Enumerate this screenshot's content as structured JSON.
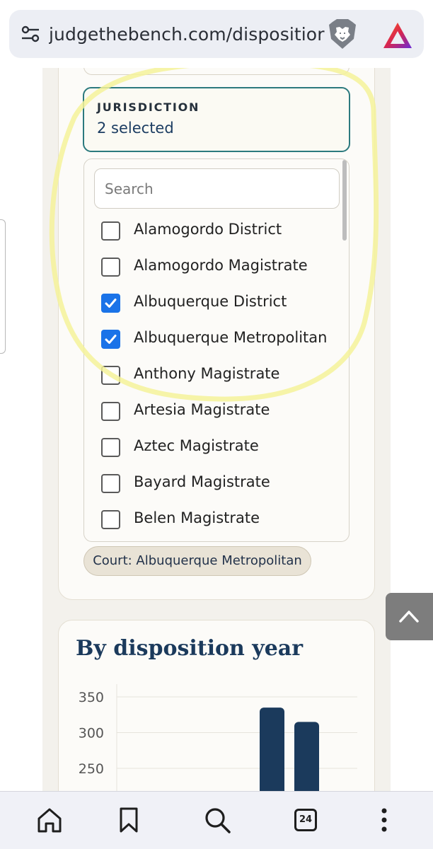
{
  "browser": {
    "url": "judgethebench.com/dispositior",
    "tab_count": "24"
  },
  "filter": {
    "jurisdiction_label": "JURISDICTION",
    "jurisdiction_value": "2 selected",
    "search_placeholder": "Search",
    "options": [
      {
        "label": "Alamogordo District",
        "checked": false
      },
      {
        "label": "Alamogordo Magistrate",
        "checked": false
      },
      {
        "label": "Albuquerque District",
        "checked": true
      },
      {
        "label": "Albuquerque Metropolitan",
        "checked": true
      },
      {
        "label": "Anthony Magistrate",
        "checked": false
      },
      {
        "label": "Artesia Magistrate",
        "checked": false
      },
      {
        "label": "Aztec Magistrate",
        "checked": false
      },
      {
        "label": "Bayard Magistrate",
        "checked": false
      },
      {
        "label": "Belen Magistrate",
        "checked": false
      }
    ],
    "active_chip": "Court: Albuquerque Metropolitan"
  },
  "chart": {
    "title": "By disposition year"
  },
  "chart_data": {
    "type": "bar",
    "title": "By disposition year",
    "y_ticks": [
      "350",
      "300",
      "250"
    ],
    "ylim": [
      200,
      350
    ],
    "values": [
      335,
      315
    ],
    "color": "#1b3a5c",
    "grid": true
  },
  "colors": {
    "accent": "#2c7a7e",
    "checkbox": "#1a73e8",
    "heading": "#1b3a5c",
    "highlight": "#f4f29a"
  }
}
